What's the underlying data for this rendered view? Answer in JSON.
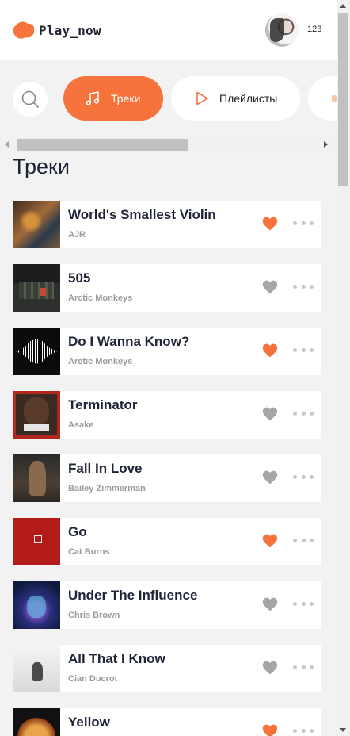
{
  "header": {
    "app_name": "Play_now",
    "user": {
      "name": "123"
    }
  },
  "tabs": [
    {
      "label": "Треки",
      "icon": "music-note-icon",
      "active": true
    },
    {
      "label": "Плейлисты",
      "icon": "play-icon",
      "active": false
    }
  ],
  "section_title": "Треки",
  "colors": {
    "accent": "#f7733c",
    "heart_liked": "#f7733c",
    "heart_default": "#a6a6a6",
    "title_text": "#1f2337",
    "artist_text": "#9b9b9b"
  },
  "tracks": [
    {
      "title": "World's Smallest Violin",
      "artist": "AJR",
      "liked": true
    },
    {
      "title": "505",
      "artist": "Arctic Monkeys",
      "liked": false
    },
    {
      "title": "Do I Wanna Know?",
      "artist": "Arctic Monkeys",
      "liked": true
    },
    {
      "title": "Terminator",
      "artist": "Asake",
      "liked": false
    },
    {
      "title": "Fall In Love",
      "artist": "Bailey Zimmerman",
      "liked": false
    },
    {
      "title": "Go",
      "artist": "Cat Burns",
      "liked": true
    },
    {
      "title": "Under The Influence",
      "artist": "Chris Brown",
      "liked": false
    },
    {
      "title": "All That I Know",
      "artist": "Cian Ducrot",
      "liked": false
    },
    {
      "title": "Yellow",
      "artist": "",
      "liked": true
    }
  ]
}
